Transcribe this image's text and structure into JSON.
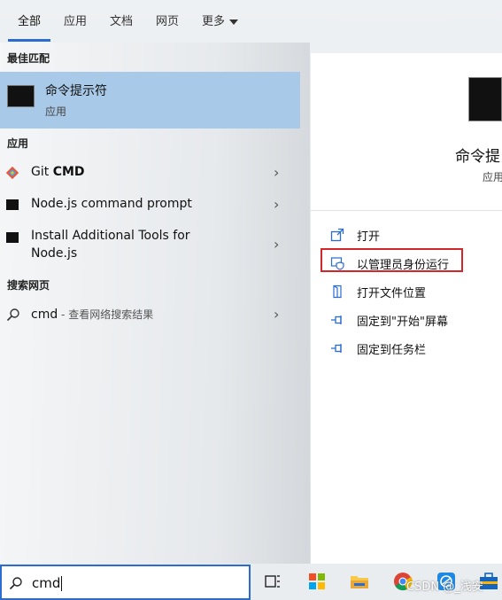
{
  "tabs": [
    {
      "label": "全部",
      "active": true
    },
    {
      "label": "应用"
    },
    {
      "label": "文档"
    },
    {
      "label": "网页"
    },
    {
      "label": "更多"
    }
  ],
  "sections": {
    "best_match": "最佳匹配",
    "apps": "应用",
    "web": "搜索网页"
  },
  "best_match": {
    "title": "命令提示符",
    "subtitle": "应用"
  },
  "apps": [
    {
      "label_prefix": "Git ",
      "label_bold": "CMD",
      "icon": "git-icon"
    },
    {
      "label": "Node.js command prompt",
      "icon": "terminal-icon"
    },
    {
      "label_line1": "Install Additional Tools for",
      "label_line2": "Node.js",
      "icon": "terminal-icon"
    }
  ],
  "web_result": {
    "query": "cmd",
    "suffix": " - 查看网络搜索结果"
  },
  "detail": {
    "app_name": "命令提",
    "app_type": "应用",
    "actions": [
      {
        "label": "打开",
        "icon": "open-icon"
      },
      {
        "label": "以管理员身份运行",
        "icon": "shield-icon",
        "highlighted": true
      },
      {
        "label": "打开文件位置",
        "icon": "folder-location-icon"
      },
      {
        "label": "固定到\"开始\"屏幕",
        "icon": "pin-icon"
      },
      {
        "label": "固定到任务栏",
        "icon": "pin-icon"
      }
    ]
  },
  "search": {
    "value": "cmd"
  },
  "watermark": "CSDN @_浅安",
  "colors": {
    "accent": "#2b6cd1",
    "selection": "#a9c9e8",
    "highlight_box": "#d3262b"
  }
}
